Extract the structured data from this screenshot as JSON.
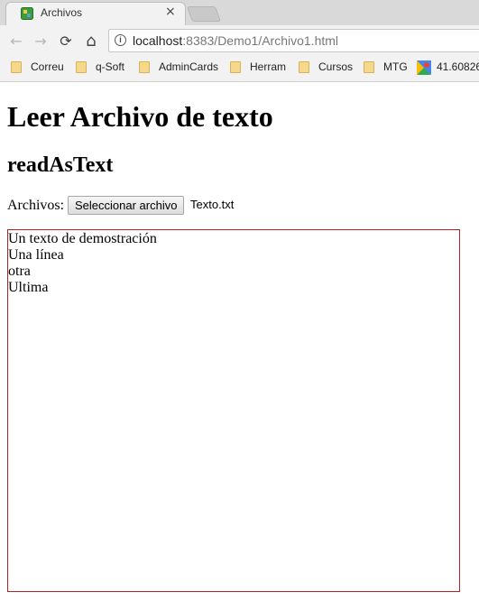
{
  "browser": {
    "tab": {
      "title": "Archivos",
      "close_glyph": "×",
      "favicon": "page-favicon"
    },
    "nav": {
      "back": "←",
      "forward": "→",
      "reload": "⟳",
      "home": "⌂"
    },
    "address": {
      "info_glyph": "i",
      "host": "localhost",
      "rest": ":8383/Demo1/Archivo1.html"
    },
    "bookmarks": [
      {
        "label": "Correu",
        "icon": "folder-icon"
      },
      {
        "label": "q-Soft",
        "icon": "folder-icon"
      },
      {
        "label": "AdminCards",
        "icon": "folder-icon"
      },
      {
        "label": "Herram",
        "icon": "folder-icon"
      },
      {
        "label": "Cursos",
        "icon": "folder-icon"
      },
      {
        "label": "MTG",
        "icon": "folder-icon"
      },
      {
        "label": "41.60826",
        "icon": "maps-icon"
      }
    ]
  },
  "page": {
    "title": "Leer Archivo de texto",
    "subtitle": "readAsText",
    "files_label": "Archivos:",
    "file_button": "Seleccionar archivo",
    "file_name": "Texto.txt",
    "output_lines": [
      "Un texto de demostración",
      "Una línea",
      "otra",
      "Ultima"
    ]
  },
  "colors": {
    "output_border": "#b22222",
    "folder": "#f5d889"
  }
}
